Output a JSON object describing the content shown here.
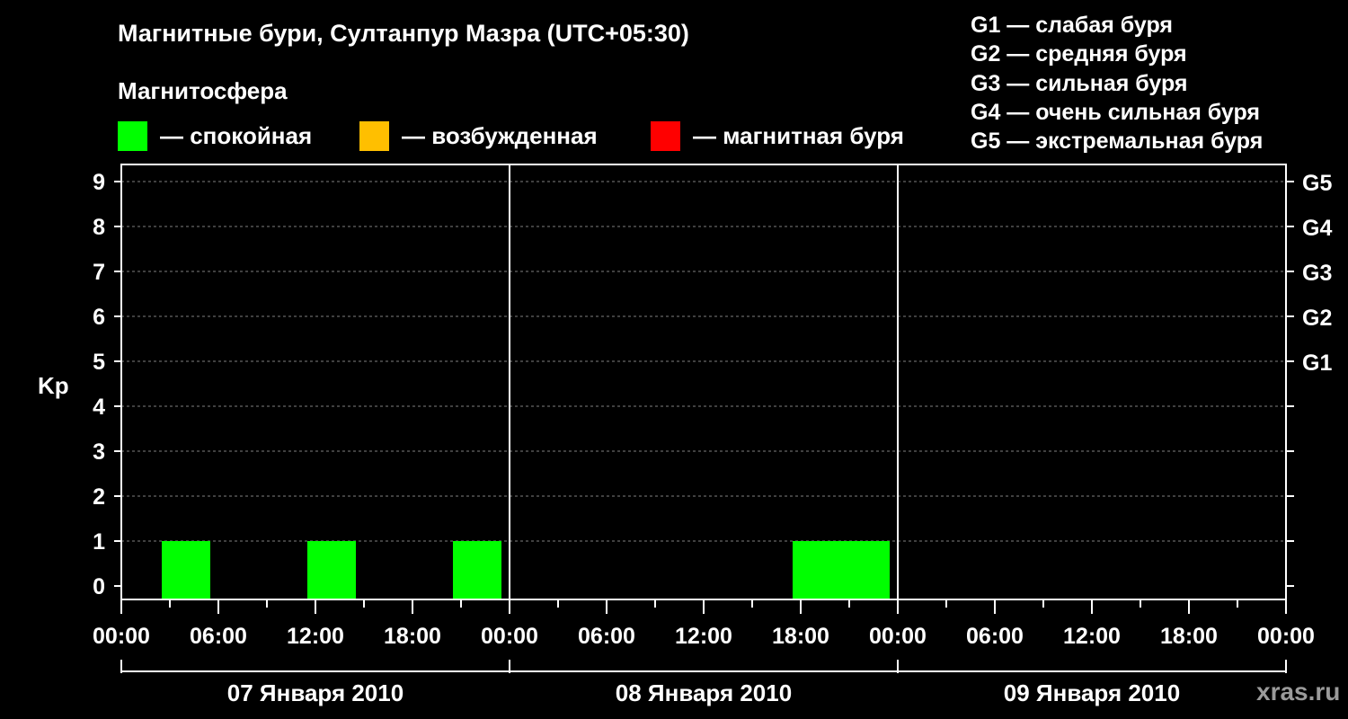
{
  "header": {
    "title": "Магнитные бури, Султанпур Мазра (UTC+05:30)",
    "subtitle": "Магнитосфера"
  },
  "legend": [
    {
      "label": "— спокойная",
      "color": "#00ff00"
    },
    {
      "label": "— возбужденная",
      "color": "#ffbf00"
    },
    {
      "label": "— магнитная буря",
      "color": "#ff0000"
    }
  ],
  "g_scale": [
    "G1 — слабая буря",
    "G2 — средняя буря",
    "G3 — сильная буря",
    "G4 — очень сильная буря",
    "G5 — экстремальная буря"
  ],
  "watermark": "xras.ru",
  "colors": {
    "background": "#000000",
    "axis": "#ffffff",
    "grid": "#808080",
    "quiet": "#00ff00"
  },
  "chart_data": {
    "type": "bar",
    "ylabel": "Kp",
    "ylim": [
      0,
      9
    ],
    "yticks": [
      "0",
      "1",
      "2",
      "3",
      "4",
      "5",
      "6",
      "7",
      "8",
      "9"
    ],
    "g_ticks": [
      {
        "kp": 5,
        "label": "G1"
      },
      {
        "kp": 6,
        "label": "G2"
      },
      {
        "kp": 7,
        "label": "G3"
      },
      {
        "kp": 8,
        "label": "G4"
      },
      {
        "kp": 9,
        "label": "G5"
      }
    ],
    "xticks": [
      "00:00",
      "06:00",
      "12:00",
      "18:00",
      "00:00",
      "06:00",
      "12:00",
      "18:00",
      "00:00",
      "06:00",
      "12:00",
      "18:00",
      "00:00"
    ],
    "days": [
      "07 Января 2010",
      "08 Января 2010",
      "09 Января 2010"
    ],
    "grid": true,
    "bars": [
      {
        "day": "07 Января 2010",
        "start": "02:30",
        "end": "05:30",
        "kp": 1,
        "level": "спокойная"
      },
      {
        "day": "07 Января 2010",
        "start": "11:30",
        "end": "14:30",
        "kp": 1,
        "level": "спокойная"
      },
      {
        "day": "07 Января 2010",
        "start": "20:30",
        "end": "23:30",
        "kp": 1,
        "level": "спокойная"
      },
      {
        "day": "08 Января 2010",
        "start": "17:30",
        "end": "20:30",
        "kp": 1,
        "level": "спокойная"
      },
      {
        "day": "08 Января 2010",
        "start": "20:30",
        "end": "23:30",
        "kp": 1,
        "level": "спокойная"
      }
    ]
  }
}
